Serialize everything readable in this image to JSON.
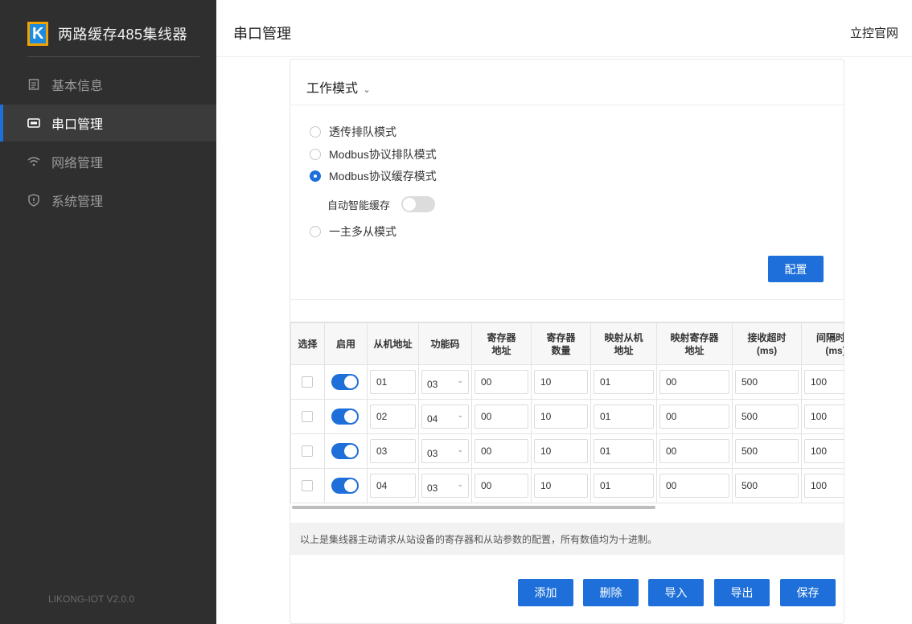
{
  "sidebar": {
    "brand_logo_letter": "K",
    "brand_title": "两路缓存485集线器",
    "items": [
      {
        "label": "基本信息",
        "icon": "document-icon"
      },
      {
        "label": "串口管理",
        "icon": "serial-port-icon"
      },
      {
        "label": "网络管理",
        "icon": "wifi-icon"
      },
      {
        "label": "系统管理",
        "icon": "shield-icon"
      }
    ],
    "active_index": 1,
    "version": "LIKONG-IOT V2.0.0"
  },
  "header": {
    "page_title": "串口管理",
    "official_link": "立控官网"
  },
  "work_mode": {
    "title": "工作模式",
    "options": [
      "透传排队模式",
      "Modbus协议排队模式",
      "Modbus协议缓存模式",
      "一主多从模式"
    ],
    "selected": "Modbus协议缓存模式",
    "auto_cache_label": "自动智能缓存",
    "auto_cache_on": false,
    "config_button": "配置"
  },
  "table": {
    "headers": {
      "select": "选择",
      "enable": "启用",
      "slave_addr": "从机地址",
      "func_code": "功能码",
      "reg_addr_1": "寄存器",
      "reg_addr_2": "地址",
      "reg_count_1": "寄存器",
      "reg_count_2": "数量",
      "map_slave_1": "映射从机",
      "map_slave_2": "地址",
      "map_reg_1": "映射寄存器",
      "map_reg_2": "地址",
      "timeout_1": "接收超时",
      "timeout_2": "(ms)",
      "interval_1": "间隔时间",
      "interval_2": "(ms)"
    },
    "rows": [
      {
        "selected": false,
        "enabled": true,
        "slave_addr": "01",
        "func_code": "03",
        "reg_addr": "00",
        "reg_count": "10",
        "map_slave": "01",
        "map_reg": "00",
        "timeout": "500",
        "interval": "100"
      },
      {
        "selected": false,
        "enabled": true,
        "slave_addr": "02",
        "func_code": "04",
        "reg_addr": "00",
        "reg_count": "10",
        "map_slave": "01",
        "map_reg": "00",
        "timeout": "500",
        "interval": "100"
      },
      {
        "selected": false,
        "enabled": true,
        "slave_addr": "03",
        "func_code": "03",
        "reg_addr": "00",
        "reg_count": "10",
        "map_slave": "01",
        "map_reg": "00",
        "timeout": "500",
        "interval": "100"
      },
      {
        "selected": false,
        "enabled": true,
        "slave_addr": "04",
        "func_code": "03",
        "reg_addr": "00",
        "reg_count": "10",
        "map_slave": "01",
        "map_reg": "00",
        "timeout": "500",
        "interval": "100"
      }
    ]
  },
  "note": "以上是集线器主动请求从站设备的寄存器和从站参数的配置，所有数值均为十进制。",
  "actions": {
    "add": "添加",
    "delete": "删除",
    "import": "导入",
    "export": "导出",
    "save": "保存"
  },
  "colors": {
    "sidebar_bg": "#2f2f2f",
    "accent": "#1e6fd9",
    "logo_orange": "#f0a300",
    "logo_blue": "#1e8be0"
  }
}
